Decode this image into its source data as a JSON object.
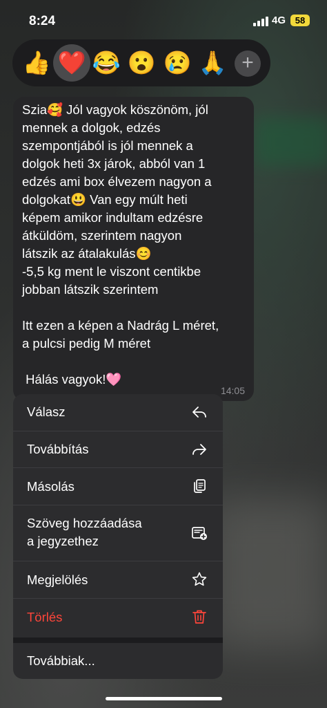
{
  "status_bar": {
    "time": "8:24",
    "network": "4G",
    "battery": "58",
    "battery_color": "#f2d93b"
  },
  "reactions": {
    "items": [
      {
        "emoji": "👍",
        "name": "thumbs-up"
      },
      {
        "emoji": "❤️",
        "name": "heart",
        "selected": true
      },
      {
        "emoji": "😂",
        "name": "tears-of-joy"
      },
      {
        "emoji": "😮",
        "name": "surprised"
      },
      {
        "emoji": "😢",
        "name": "crying"
      },
      {
        "emoji": "🙏",
        "name": "folded-hands"
      }
    ],
    "more": "+"
  },
  "message": {
    "text": "Szia🥰 Jól vagyok köszönöm, jól\nmennek a dolgok, edzés\nszempontjából is jól mennek a\ndolgok heti 3x járok, abból van 1\nedzés ami box élvezem nagyon a\ndolgokat😃 Van egy múlt heti\nképem amikor indultam edzésre\nátküldöm, szerintem nagyon\nlátszik az átalakulás😊\n-5,5 kg ment le viszont centikbe\njobban látszik szerintem\n\nItt ezen a képen a Nadrág L méret,\na pulcsi pedig M méret\n\n Hálás vagyok!🩷",
    "time": "14:05"
  },
  "menu": {
    "reply": "Válasz",
    "forward": "Továbbítás",
    "copy": "Másolás",
    "add_note": "Szöveg hozzáadása\na jegyzethez",
    "star": "Megjelölés",
    "delete": "Törlés",
    "more": "Továbbiak...",
    "delete_color": "#ff453a"
  }
}
